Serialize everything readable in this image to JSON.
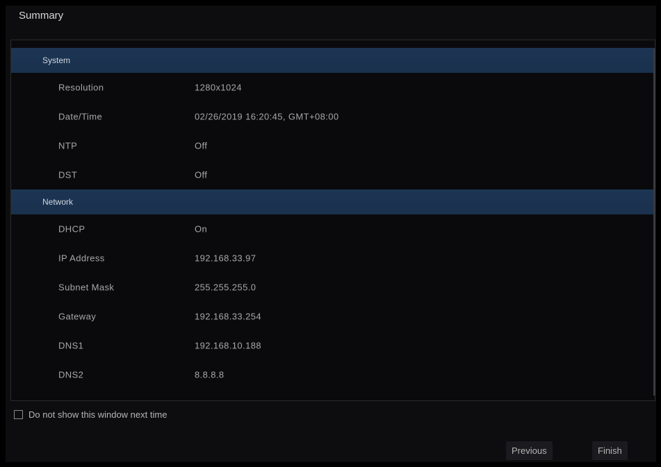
{
  "window": {
    "title": "Summary"
  },
  "system": {
    "label": "System",
    "rows": [
      {
        "key": "Resolution",
        "value": "1280x1024"
      },
      {
        "key": "Date/Time",
        "value": "02/26/2019 16:20:45, GMT+08:00"
      },
      {
        "key": "NTP",
        "value": "Off"
      },
      {
        "key": "DST",
        "value": "Off"
      }
    ]
  },
  "network": {
    "label": "Network",
    "rows": [
      {
        "key": "DHCP",
        "value": "On"
      },
      {
        "key": "IP Address",
        "value": "192.168.33.97"
      },
      {
        "key": "Subnet Mask",
        "value": "255.255.255.0"
      },
      {
        "key": "Gateway",
        "value": "192.168.33.254"
      },
      {
        "key": "DNS1",
        "value": "192.168.10.188"
      },
      {
        "key": "DNS2",
        "value": "8.8.8.8"
      }
    ]
  },
  "footer": {
    "checkbox_label": "Do not show this window next time",
    "checkbox_checked": false,
    "previous_label": "Previous",
    "finish_label": "Finish"
  },
  "colors": {
    "section_header": "#1c3553",
    "background": "#0d0d0f",
    "text": "#a7a7a7"
  }
}
